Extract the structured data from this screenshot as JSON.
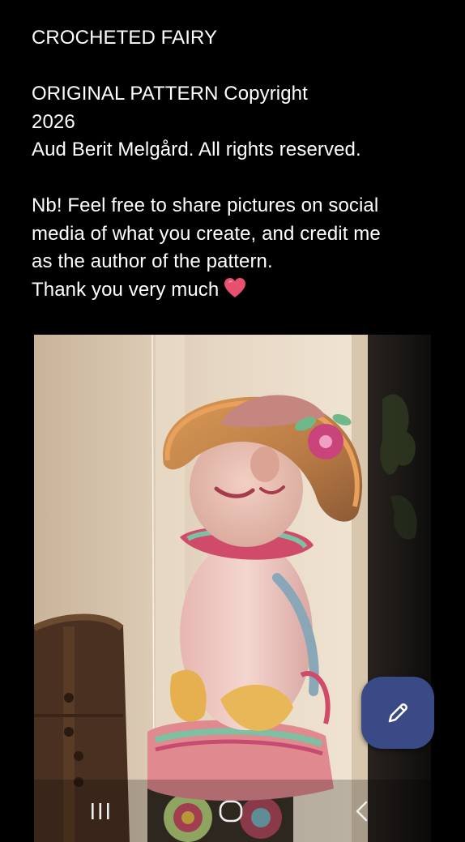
{
  "post": {
    "title": "CROCHETED FAIRY",
    "copyright_line1": "ORIGINAL PATTERN Copyright",
    "copyright_line2": "2026",
    "copyright_line3": "Aud Berit Melgård. All rights reserved.",
    "note_line1": "Nb! Feel free to share pictures on social",
    "note_line2": "media of what you create, and credit me",
    "note_line3": "as the author of the pattern.",
    "note_line4": "Thank you very much",
    "heart_emoji": "heart-icon"
  },
  "photo": {
    "subject": "crocheted-fairy-doll"
  },
  "fab": {
    "icon": "pencil-icon",
    "color": "#3a4a86"
  },
  "navbar": {
    "recents_icon": "recents-icon",
    "home_icon": "home-icon",
    "back_icon": "back-icon"
  },
  "colors": {
    "background": "#000000",
    "text": "#ffffff",
    "heart": "#e8506e"
  }
}
